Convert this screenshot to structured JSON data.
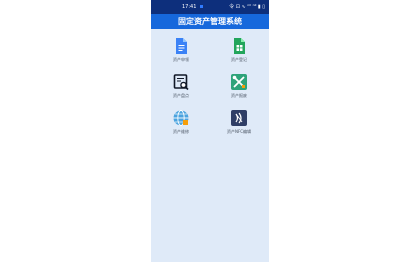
{
  "status_bar": {
    "time": "17:41",
    "right_indicators": "令 ⊡ ∿ ⁿⁱˡ ⁿⁱˡ ▮ ▯"
  },
  "header": {
    "title": "固定资产管理系统"
  },
  "tiles": [
    {
      "label": "资产申领",
      "icon": "document-icon",
      "color": "#3b82f6"
    },
    {
      "label": "资产登记",
      "icon": "spreadsheet-icon",
      "color": "#22a55b"
    },
    {
      "label": "资产盘点",
      "icon": "search-document-icon",
      "color": "#111827"
    },
    {
      "label": "资产报废",
      "icon": "tools-icon",
      "color": "#2ea37a"
    },
    {
      "label": "资产维修",
      "icon": "globe-icon",
      "color": "#4aa3df"
    },
    {
      "label": "资产NFC编辑",
      "icon": "nfc-icon",
      "color": "#2f3e66"
    }
  ],
  "colors": {
    "status_bar_bg": "#0d2f7c",
    "title_bar_bg": "#1668dc",
    "page_bg": "#dfeaf8"
  }
}
